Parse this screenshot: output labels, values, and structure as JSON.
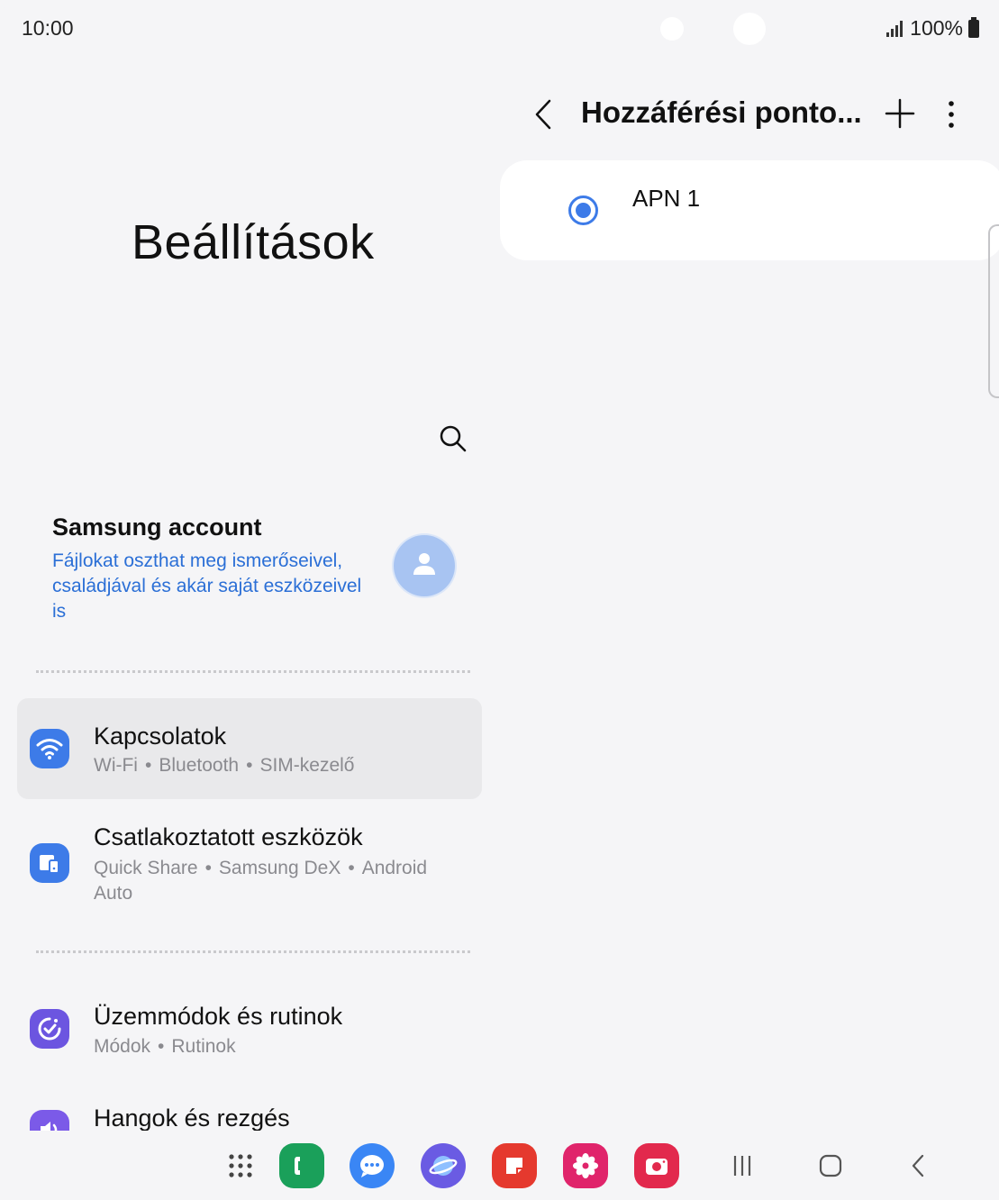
{
  "status_bar": {
    "time": "10:00",
    "battery": "100%"
  },
  "settings": {
    "title": "Beállítások",
    "search_icon": "search-icon",
    "account": {
      "title": "Samsung account",
      "description": "Fájlokat oszthat meg ismerőseivel, családjával és akár saját eszközeivel is"
    },
    "items": [
      {
        "title": "Kapcsolatok",
        "subtitles": [
          "Wi-Fi",
          "Bluetooth",
          "SIM-kezelő"
        ],
        "icon": "wifi-icon",
        "color": "#3d7be8",
        "selected": true
      },
      {
        "title": "Csatlakoztatott eszközök",
        "subtitles": [
          "Quick Share",
          "Samsung DeX",
          "Android Auto"
        ],
        "icon": "connected-devices-icon",
        "color": "#3d7be8"
      },
      {
        "title": "Üzemmódok és rutinok",
        "subtitles": [
          "Módok",
          "Rutinok"
        ],
        "icon": "routines-icon",
        "color": "#6c55e0"
      },
      {
        "title": "Hangok és rezgés",
        "subtitles": [],
        "icon": "sound-icon",
        "color": "#7b5ae8"
      }
    ]
  },
  "apn_panel": {
    "title": "Hozzáférési ponto...",
    "apn_entries": [
      {
        "label": "APN 1",
        "selected": true
      }
    ]
  },
  "dock": {
    "apps": [
      "apps-grid-icon",
      "phone-icon",
      "messages-icon",
      "internet-icon",
      "notes-icon",
      "gallery-icon",
      "camera-icon"
    ],
    "colors": {
      "phone": "#1aa05a",
      "messages": "#3a86f5",
      "internet": "#6a5be3",
      "notes": "#e5392e",
      "gallery": "#e0246b",
      "camera": "#e2294d"
    }
  }
}
